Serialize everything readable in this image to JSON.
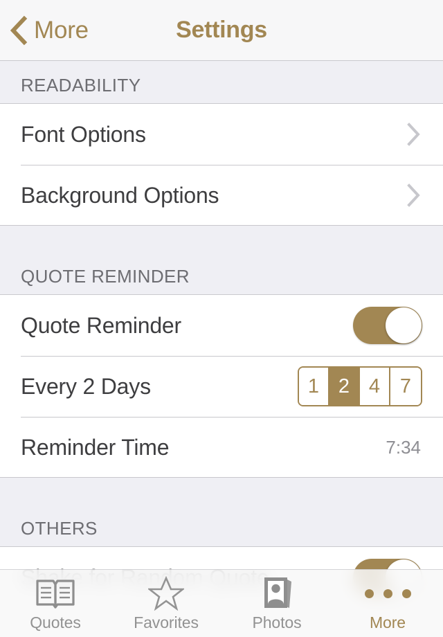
{
  "navbar": {
    "back_label": "More",
    "back_icon": "chevron-left-icon",
    "title": "Settings",
    "accent_color": "#A28753"
  },
  "sections": [
    {
      "header": "READABILITY",
      "rows": [
        {
          "label": "Font Options",
          "accessory": "disclosure-chevron-icon"
        },
        {
          "label": "Background Options",
          "accessory": "disclosure-chevron-icon"
        }
      ]
    },
    {
      "header": "QUOTE REMINDER",
      "rows": [
        {
          "label": "Quote Reminder",
          "accessory": "toggle-switch",
          "toggle_on": true
        },
        {
          "label": "Every 2 Days",
          "accessory": "segmented-control",
          "options": [
            "1",
            "2",
            "4",
            "7"
          ],
          "selected_option": "2"
        },
        {
          "label": "Reminder Time",
          "accessory": "value",
          "value": "7:34"
        }
      ]
    },
    {
      "header": "OTHERS",
      "rows": [
        {
          "label": "Shake for Random Quote",
          "accessory": "toggle-switch",
          "toggle_on": true
        }
      ]
    }
  ],
  "tabbar": {
    "items": [
      {
        "label": "Quotes",
        "icon": "book-icon",
        "active": false
      },
      {
        "label": "Favorites",
        "icon": "star-icon",
        "active": false
      },
      {
        "label": "Photos",
        "icon": "photo-frame-icon",
        "active": false
      },
      {
        "label": "More",
        "icon": "ellipsis-icon",
        "active": true
      }
    ]
  },
  "colors": {
    "accent": "#A28753",
    "section_header_bg": "#EFEFF4",
    "section_header_text": "#6D6D72",
    "row_text": "#3E3E40",
    "value_text": "#8E8E93",
    "tab_inactive": "#929292"
  }
}
